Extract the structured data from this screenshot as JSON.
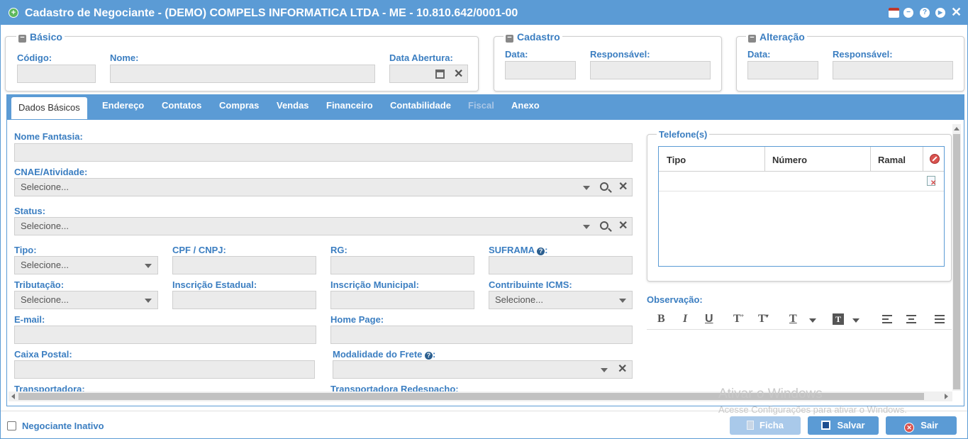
{
  "window": {
    "title": "Cadastro de Negociante - (DEMO) COMPELS INFORMATICA LTDA - ME - 10.810.642/0001-00"
  },
  "basico": {
    "legend": "Básico",
    "codigo_label": "Código:",
    "nome_label": "Nome:",
    "data_abertura_label": "Data Abertura:"
  },
  "cadastro": {
    "legend": "Cadastro",
    "data_label": "Data:",
    "responsavel_label": "Responsável:"
  },
  "alteracao": {
    "legend": "Alteração",
    "data_label": "Data:",
    "responsavel_label": "Responsável:"
  },
  "tabs": [
    {
      "label": "Dados Básicos"
    },
    {
      "label": "Endereço"
    },
    {
      "label": "Contatos"
    },
    {
      "label": "Compras"
    },
    {
      "label": "Vendas"
    },
    {
      "label": "Financeiro"
    },
    {
      "label": "Contabilidade"
    },
    {
      "label": "Fiscal"
    },
    {
      "label": "Anexo"
    }
  ],
  "form": {
    "nome_fantasia_label": "Nome Fantasia:",
    "cnae_label": "CNAE/Atividade:",
    "cnae_value": "Selecione...",
    "status_label": "Status:",
    "status_value": "Selecione...",
    "tipo_label": "Tipo:",
    "tipo_value": "Selecione...",
    "cpf_cnpj_label": "CPF / CNPJ:",
    "rg_label": "RG:",
    "suframa_label": "SUFRAMA",
    "suframa_colon": ":",
    "tributacao_label": "Tributação:",
    "tributacao_value": "Selecione...",
    "ie_label": "Inscrição Estadual:",
    "im_label": "Inscrição Municipal:",
    "icms_label": "Contribuinte ICMS:",
    "icms_value": "Selecione...",
    "email_label": "E-mail:",
    "homepage_label": "Home Page:",
    "caixa_postal_label": "Caixa Postal:",
    "frete_label": "Modalidade do Frete",
    "frete_colon": ":",
    "transportadora_label": "Transportadora:",
    "redespacho_label": "Transportadora Redespacho:"
  },
  "telefones": {
    "legend": "Telefone(s)",
    "columns": [
      "Tipo",
      "Número",
      "Ramal"
    ]
  },
  "observacao": {
    "label": "Observação:"
  },
  "footer": {
    "inativo_label": "Negociante Inativo",
    "ficha_label": "Ficha",
    "salvar_label": "Salvar",
    "sair_label": "Sair"
  },
  "watermark": {
    "line1": "Ativar o Windows",
    "line2": "Acesse Configurações para ativar o Windows."
  },
  "colors": {
    "accent": "#5b9bd5",
    "label": "#3b7ec1",
    "danger": "#d9534f"
  }
}
